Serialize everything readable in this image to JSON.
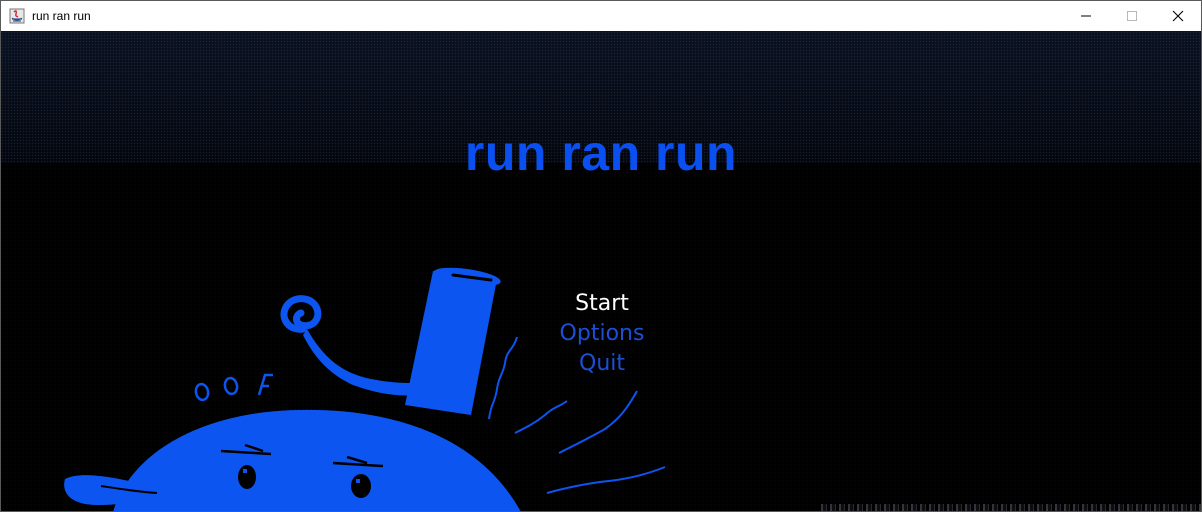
{
  "window": {
    "title": "run ran run",
    "controls": {
      "minimize_icon": "minimize-icon",
      "maximize_icon": "maximize-icon",
      "close_icon": "close-icon"
    }
  },
  "game": {
    "title": "run ran run",
    "title_color": "#0a4ff0",
    "menu": {
      "items": [
        {
          "label": "Start",
          "selected": true
        },
        {
          "label": "Options",
          "selected": false
        },
        {
          "label": "Quit",
          "selected": false
        }
      ],
      "selected_color": "#ffffff",
      "normal_color": "#1a4fd6"
    },
    "character": {
      "name": "blue-blob-character",
      "exclamation_text": "OOF",
      "color": "#0d55f0"
    }
  }
}
